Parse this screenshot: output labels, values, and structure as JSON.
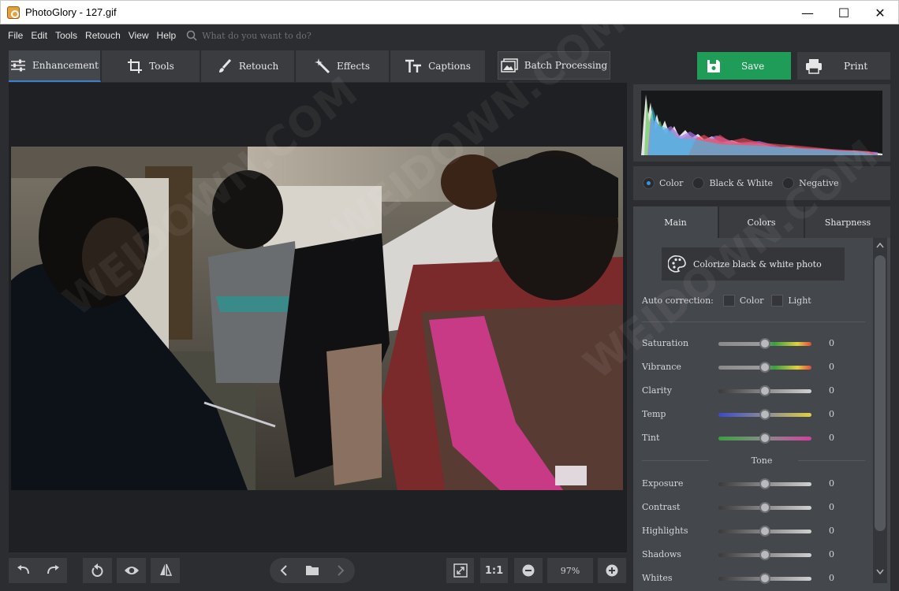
{
  "app": {
    "title": "PhotoGlory - 127.gif"
  },
  "window_controls": {
    "minimize": "—",
    "maximize": "☐",
    "close": "✕"
  },
  "menu": {
    "items": [
      "File",
      "Edit",
      "Tools",
      "Retouch",
      "View",
      "Help"
    ],
    "search_placeholder": "What do you want to do?"
  },
  "tabs": [
    {
      "label": "Enhancement",
      "icon": "sliders-icon",
      "active": true
    },
    {
      "label": "Tools",
      "icon": "crop-icon",
      "active": false
    },
    {
      "label": "Retouch",
      "icon": "brush-icon",
      "active": false
    },
    {
      "label": "Effects",
      "icon": "magic-wand-icon",
      "active": false
    },
    {
      "label": "Captions",
      "icon": "text-icon",
      "active": false
    },
    {
      "label": "Batch Processing",
      "icon": "images-icon",
      "active": false
    }
  ],
  "actions": {
    "save": "Save",
    "print": "Print"
  },
  "color_modes": {
    "selected": "Color",
    "options": [
      "Color",
      "Black & White",
      "Negative"
    ]
  },
  "sub_tabs": [
    "Main",
    "Colors",
    "Sharpness"
  ],
  "main_panel": {
    "colorize_button": "Colorize black & white photo",
    "auto_correction": {
      "label": "Auto correction:",
      "options": [
        "Color",
        "Light"
      ]
    },
    "sliders": [
      {
        "label": "Saturation",
        "value": "0"
      },
      {
        "label": "Vibrance",
        "value": "0"
      },
      {
        "label": "Clarity",
        "value": "0"
      },
      {
        "label": "Temp",
        "value": "0"
      },
      {
        "label": "Tint",
        "value": "0"
      }
    ],
    "tone_heading": "Tone",
    "tone_sliders": [
      {
        "label": "Exposure",
        "value": "0"
      },
      {
        "label": "Contrast",
        "value": "0"
      },
      {
        "label": "Highlights",
        "value": "0"
      },
      {
        "label": "Shadows",
        "value": "0"
      },
      {
        "label": "Whites",
        "value": "0"
      }
    ]
  },
  "bottom_toolbar": {
    "ratio_label": "1:1",
    "zoom_value": "97%"
  },
  "watermark_text": "WEIDOWN.COM",
  "colors": {
    "accent": "#3f7fd0",
    "save_green": "#1f9c58"
  }
}
